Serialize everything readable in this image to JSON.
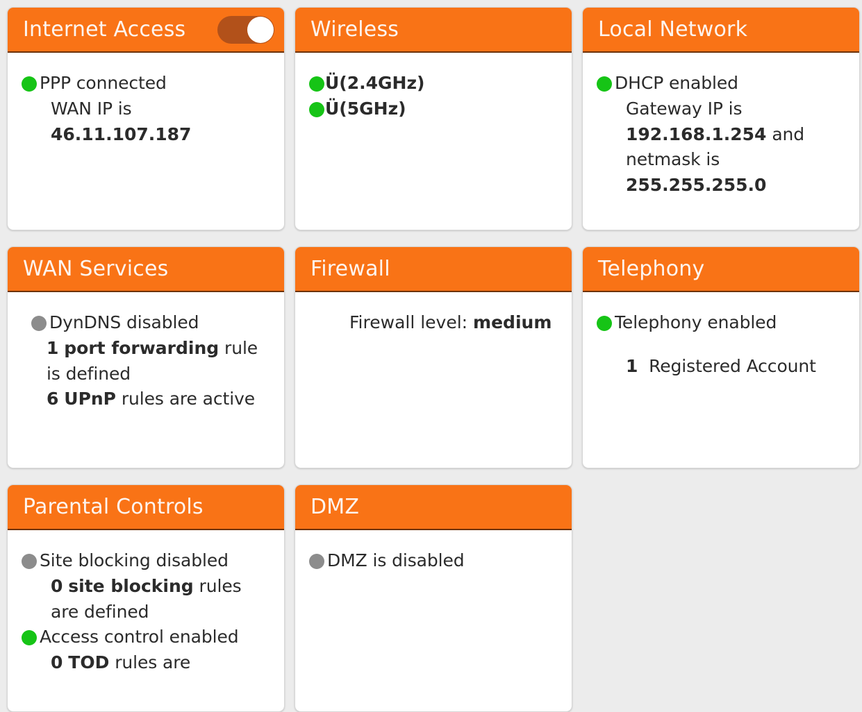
{
  "theme": {
    "header_bg": "#f97316",
    "header_text": "#fdf4ef",
    "page_bg": "#ececec",
    "card_bg": "#ffffff",
    "status_on": "#16c416",
    "status_off": "#8c8c8c",
    "toggle_track": "#b2511a",
    "toggle_knob": "#ffffff",
    "body_text": "#2b2b2b"
  },
  "cards": {
    "internet_access": {
      "title": "Internet Access",
      "toggle_state": "on",
      "status_label": "PPP connected",
      "wan_ip_label": "WAN IP is",
      "wan_ip_value": "46.11.107.187"
    },
    "wireless": {
      "title": "Wireless",
      "band_24": "Ü(2.4GHz)",
      "band_5": "Ü(5GHz)"
    },
    "local_network": {
      "title": "Local Network",
      "status_label": "DHCP enabled",
      "gateway_label": "Gateway IP is",
      "gateway_value": "192.168.1.254",
      "gateway_suffix": "and",
      "netmask_label": "netmask is",
      "netmask_value": "255.255.255.0"
    },
    "wan_services": {
      "title": "WAN Services",
      "dyndns_label": "DynDNS disabled",
      "port_forwarding_count": "1",
      "port_forwarding_name": "port forwarding",
      "port_forwarding_suffix": "rule",
      "port_forwarding_suffix2": "is defined",
      "upnp_count": "6",
      "upnp_name": "UPnP",
      "upnp_suffix": "rules are active"
    },
    "firewall": {
      "title": "Firewall",
      "level_label": "Firewall level:",
      "level_value": "medium"
    },
    "telephony": {
      "title": "Telephony",
      "status_label": "Telephony enabled",
      "accounts_count": "1",
      "accounts_label": "Registered Account"
    },
    "parental_controls": {
      "title": "Parental Controls",
      "site_blocking_status": "Site blocking disabled",
      "site_blocking_count": "0",
      "site_blocking_name": "site blocking",
      "site_blocking_suffix": "rules",
      "site_blocking_suffix2": "are defined",
      "access_control_status": "Access control enabled",
      "tod_count": "0",
      "tod_name": "TOD",
      "tod_suffix": "rules are"
    },
    "dmz": {
      "title": "DMZ",
      "status_label": "DMZ is disabled"
    }
  }
}
